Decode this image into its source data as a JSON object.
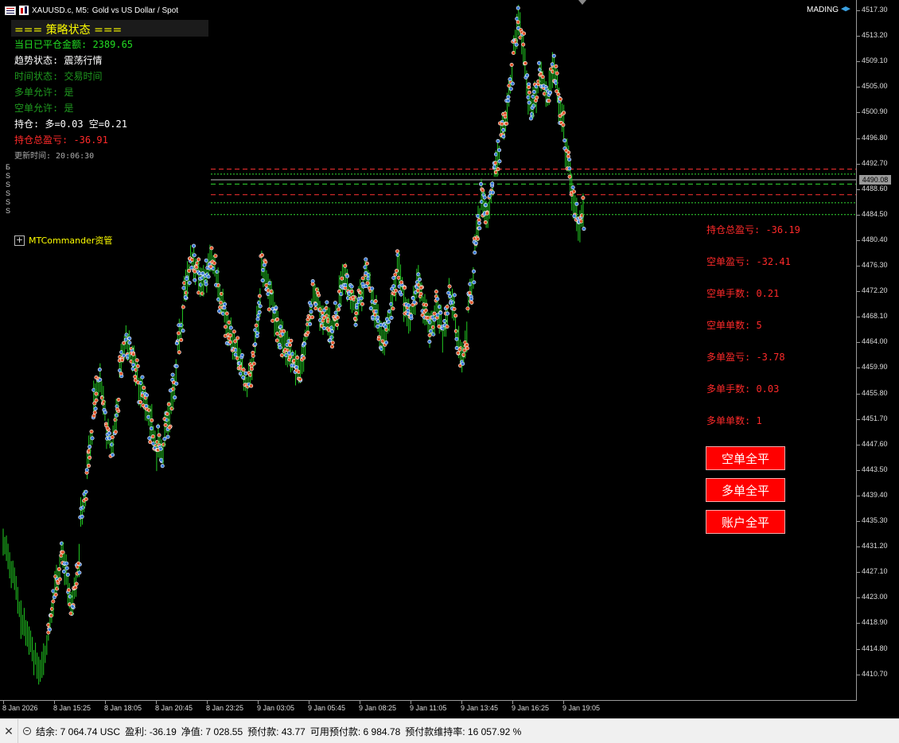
{
  "header": {
    "symbol_title": "XAUUSD.c, M5:",
    "description": "Gold vs US Dollar / Spot",
    "account_label": "MADING",
    "icon_left": "menu-icon",
    "icon_chart": "chart-icon",
    "icon_account": "graduation-cap-icon"
  },
  "status_panel": {
    "title": "=== 策略状态 ===",
    "lines": [
      {
        "text": "当日已平仓金额: 2389.65",
        "color": "#22dd22"
      },
      {
        "text": "趋势状态: 震荡行情",
        "color": "#ffffff"
      },
      {
        "text": "时间状态: 交易时间",
        "color": "#1f9a1f"
      },
      {
        "text": "多单允许: 是",
        "color": "#1f9a1f"
      },
      {
        "text": "空单允许: 是",
        "color": "#1f9a1f"
      },
      {
        "text": "持仓: 多=0.03 空=0.21",
        "color": "#ffffff"
      },
      {
        "text": "持仓总盈亏: -36.91",
        "color": "#ff2a2a"
      },
      {
        "text": "更新时间: 20:06:30",
        "color": "#aaaaaa"
      }
    ]
  },
  "left_letters": [
    "Б",
    "S",
    "S",
    "S",
    "S",
    "S"
  ],
  "mtcommander": {
    "label": "MTCommander资管",
    "icon": "plus-box-icon"
  },
  "right_info": [
    "持仓总盈亏: -36.19",
    "空单盈亏: -32.41",
    "空单手数: 0.21",
    "空单单数: 5",
    "多单盈亏: -3.78",
    "多单手数: 0.03",
    "多单单数: 1"
  ],
  "buttons": {
    "close_short": "空单全平",
    "close_long": "多单全平",
    "close_account": "账户全平"
  },
  "price_axis": [
    "4517.30",
    "4513.20",
    "4509.10",
    "4505.00",
    "4500.90",
    "4496.80",
    "4492.70",
    "4488.60",
    "4484.50",
    "4480.40",
    "4476.30",
    "4472.20",
    "4468.10",
    "4464.00",
    "4459.90",
    "4455.80",
    "4451.70",
    "4447.60",
    "4443.50",
    "4439.40",
    "4435.30",
    "4431.20",
    "4427.10",
    "4423.00",
    "4418.90",
    "4414.80",
    "4410.70"
  ],
  "current_price": "4490.08",
  "time_axis": [
    "8 Jan 2026",
    "8 Jan 15:25",
    "8 Jan 18:05",
    "8 Jan 20:45",
    "8 Jan 23:25",
    "9 Jan 03:05",
    "9 Jan 05:45",
    "9 Jan 08:25",
    "9 Jan 11:05",
    "9 Jan 13:45",
    "9 Jan 16:25",
    "9 Jan 19:05"
  ],
  "footer": {
    "balance": "结余: 7 064.74 USC",
    "profit": "盈利: -36.19",
    "equity": "净值: 7 028.55",
    "margin": "预付款: 43.77",
    "free_margin": "可用预付款: 6 984.78",
    "margin_level": "预付款维持率: 16 057.92 %",
    "close_icon": "close-icon",
    "minus_icon": "minus-circle-icon"
  },
  "chart_data": {
    "type": "candlestick",
    "symbol": "XAUUSD.c",
    "timeframe": "M5",
    "ylim": [
      4408.5,
      4518.5
    ],
    "x_tick_labels": [
      "8 Jan 2026",
      "8 Jan 15:25",
      "8 Jan 18:05",
      "8 Jan 20:45",
      "8 Jan 23:25",
      "9 Jan 03:05",
      "9 Jan 05:45",
      "9 Jan 08:25",
      "9 Jan 11:05",
      "9 Jan 13:45",
      "9 Jan 16:25",
      "9 Jan 19:05"
    ],
    "price_path": [
      [
        4432,
        4430
      ],
      [
        4428,
        4425
      ],
      [
        4424,
        4418
      ],
      [
        4419,
        4416
      ],
      [
        4417,
        4412
      ],
      [
        4414,
        4410
      ],
      [
        4412,
        4416
      ],
      [
        4418,
        4422
      ],
      [
        4425,
        4428
      ],
      [
        4430,
        4426
      ],
      [
        4424,
        4421
      ],
      [
        4424,
        4431
      ],
      [
        4436,
        4440
      ],
      [
        4445,
        4450
      ],
      [
        4455,
        4458
      ],
      [
        4458,
        4452
      ],
      [
        4450,
        4446
      ],
      [
        4449,
        4455
      ],
      [
        4460,
        4464
      ],
      [
        4465,
        4461
      ],
      [
        4462,
        4458
      ],
      [
        4457,
        4455
      ],
      [
        4454,
        4450
      ],
      [
        4451,
        4445
      ],
      [
        4448,
        4446
      ],
      [
        4450,
        4453
      ],
      [
        4455,
        4460
      ],
      [
        4464,
        4468
      ],
      [
        4472,
        4476
      ],
      [
        4478,
        4475
      ],
      [
        4476,
        4472
      ],
      [
        4474,
        4476
      ],
      [
        4478,
        4475
      ],
      [
        4474,
        4470
      ],
      [
        4470,
        4465
      ],
      [
        4466,
        4462
      ],
      [
        4463,
        4460
      ],
      [
        4460,
        4455
      ],
      [
        4458,
        4462
      ],
      [
        4465,
        4472
      ],
      [
        4476,
        4474
      ],
      [
        4472,
        4470
      ],
      [
        4468,
        4464
      ],
      [
        4465,
        4462
      ],
      [
        4463,
        4460
      ],
      [
        4461,
        4458
      ],
      [
        4460,
        4464
      ],
      [
        4466,
        4470
      ],
      [
        4472,
        4470
      ],
      [
        4469,
        4467
      ],
      [
        4468,
        4465
      ],
      [
        4466,
        4470
      ],
      [
        4472,
        4476
      ],
      [
        4474,
        4470
      ],
      [
        4471,
        4468
      ],
      [
        4470,
        4474
      ],
      [
        4476,
        4472
      ],
      [
        4471,
        4468
      ],
      [
        4467,
        4464
      ],
      [
        4465,
        4468
      ],
      [
        4470,
        4475
      ],
      [
        4477,
        4472
      ],
      [
        4470,
        4468
      ],
      [
        4468,
        4472
      ],
      [
        4474,
        4472
      ],
      [
        4470,
        4467
      ],
      [
        4466,
        4468
      ],
      [
        4470,
        4466
      ],
      [
        4465,
        4470
      ],
      [
        4472,
        4468
      ],
      [
        4466,
        4462
      ],
      [
        4461,
        4466
      ],
      [
        4470,
        4476
      ],
      [
        4480,
        4486
      ],
      [
        4488,
        4484
      ],
      [
        4485,
        4490
      ],
      [
        4492,
        4495
      ],
      [
        4498,
        4500
      ],
      [
        4502,
        4508
      ],
      [
        4512,
        4516
      ],
      [
        4514,
        4508
      ],
      [
        4505,
        4500
      ],
      [
        4502,
        4506
      ],
      [
        4508,
        4504
      ],
      [
        4503,
        4506
      ],
      [
        4508,
        4504
      ],
      [
        4502,
        4498
      ],
      [
        4495,
        4490
      ],
      [
        4488,
        4484
      ],
      [
        4482,
        4486
      ]
    ],
    "horizontal_levels": [
      {
        "price": 4491.8,
        "style": "dashed",
        "color": "#ff3333"
      },
      {
        "price": 4491.0,
        "style": "dotted",
        "color": "#33dd33"
      },
      {
        "price": 4490.1,
        "style": "solid",
        "color": "#bbbbbb"
      },
      {
        "price": 4489.4,
        "style": "dashed",
        "color": "#33dd33"
      },
      {
        "price": 4487.7,
        "style": "dashed",
        "color": "#ff3333"
      },
      {
        "price": 4486.4,
        "style": "dotted",
        "color": "#33dd33"
      },
      {
        "price": 4484.5,
        "style": "dotted",
        "color": "#33dd33"
      }
    ],
    "bar_color": "#22cc22",
    "buy_marker_color": "#3a7ad6",
    "sell_marker_color": "#e0552a"
  }
}
